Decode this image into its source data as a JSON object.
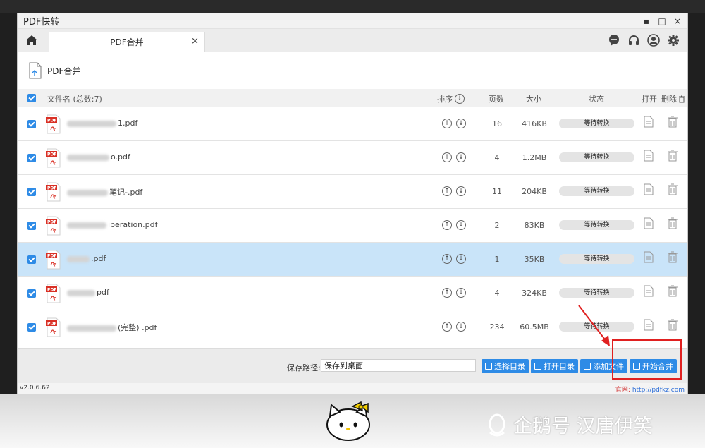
{
  "app": {
    "title": "PDF快转"
  },
  "window_controls": {
    "minimize": "▪",
    "maximize": "□",
    "close": "×"
  },
  "tabs": [
    {
      "label": "PDF合并",
      "close": "×"
    }
  ],
  "subheader": {
    "title": "PDF合并"
  },
  "list_header": {
    "filename": "文件名 (总数:7)",
    "sort": "排序",
    "pages": "页数",
    "size": "大小",
    "status": "状态",
    "open": "打开",
    "delete": "删除"
  },
  "files": [
    {
      "name_suffix": "1.pdf",
      "pages": "16",
      "size": "416KB",
      "status": "等待转换"
    },
    {
      "name_suffix": "o.pdf",
      "pages": "4",
      "size": "1.2MB",
      "status": "等待转换"
    },
    {
      "name_suffix": "笔记-.pdf",
      "pages": "11",
      "size": "204KB",
      "status": "等待转换"
    },
    {
      "name_suffix": "iberation.pdf",
      "pages": "2",
      "size": "83KB",
      "status": "等待转换"
    },
    {
      "name_suffix": ".pdf",
      "pages": "1",
      "size": "35KB",
      "status": "等待转换"
    },
    {
      "name_suffix": "pdf",
      "pages": "4",
      "size": "324KB",
      "status": "等待转换"
    },
    {
      "name_suffix": "(完整) .pdf",
      "pages": "234",
      "size": "60.5MB",
      "status": "等待转换"
    }
  ],
  "bottom": {
    "save_path_label": "保存路径:",
    "save_path_value": "保存到桌面",
    "select_dir": "选择目录",
    "open_dir": "打开目录",
    "add_file": "添加文件",
    "start_merge": "开始合并"
  },
  "statusbar": {
    "version": "v2.0.6.62",
    "site_label": "官网:",
    "site_url": "http://pdfkz.com"
  },
  "watermark": {
    "text": "企鹅号 汉唐伊笑"
  },
  "colors": {
    "accent": "#2e8be6",
    "selected_row": "#c9e4f9",
    "highlight": "#e02020"
  },
  "selected_row_index": 4
}
